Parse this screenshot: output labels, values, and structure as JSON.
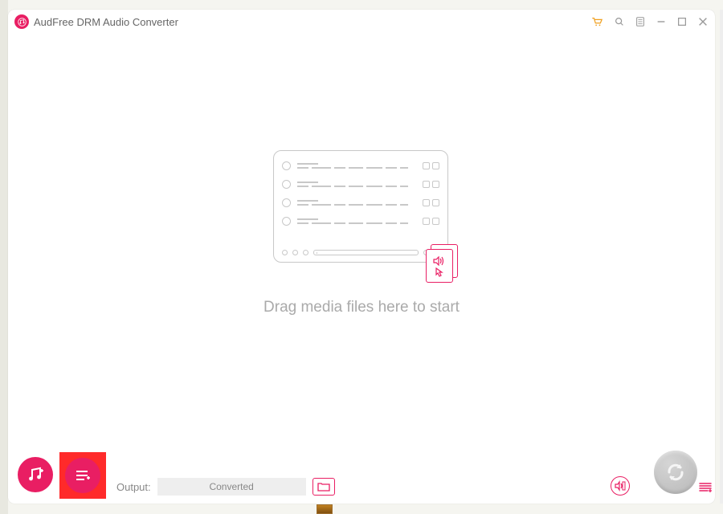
{
  "app": {
    "title": "AudFree DRM Audio Converter",
    "brand_color": "#e91e63",
    "icons": {
      "cart": "cart-icon",
      "search": "search-icon",
      "menu": "menu-icon",
      "minimize": "minimize-icon",
      "maximize": "maximize-icon",
      "close": "close-icon"
    }
  },
  "main": {
    "drop_hint": "Drag media files here to start"
  },
  "footer": {
    "output_label": "Output:",
    "output_folder": "Converted"
  }
}
